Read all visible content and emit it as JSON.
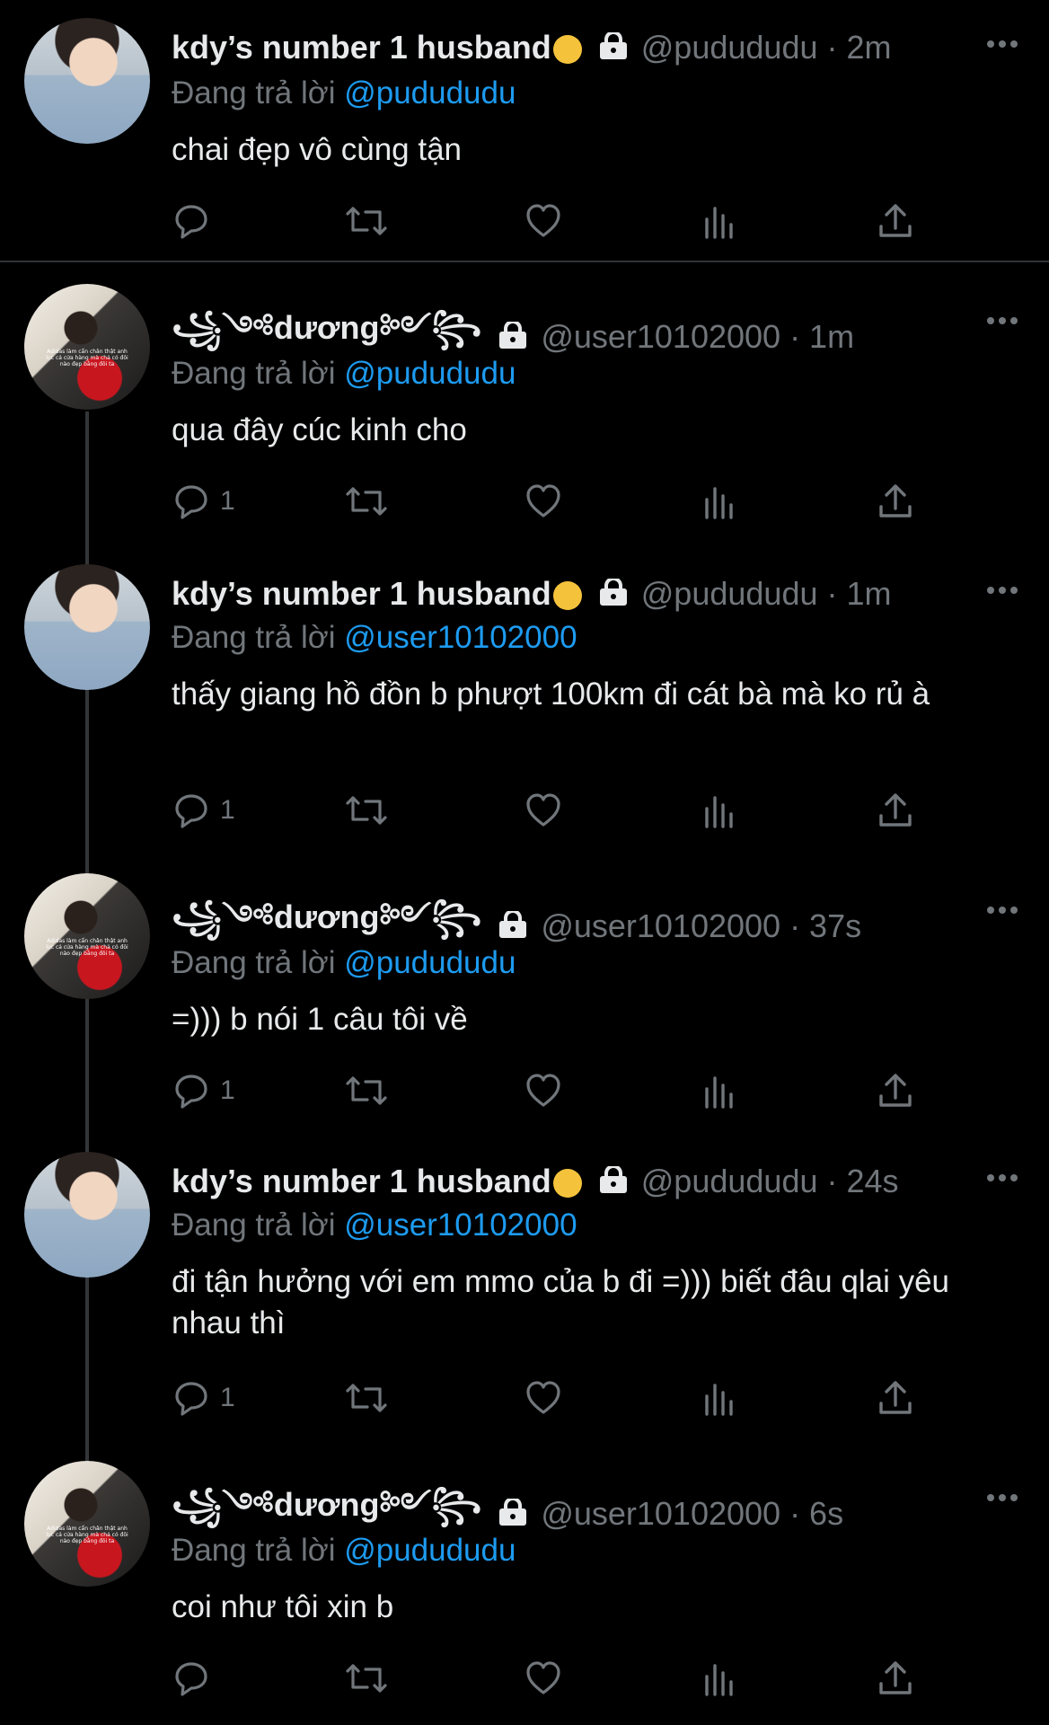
{
  "reply_prefix": "Đang trả lời",
  "tweets": [
    {
      "name": "kdy’s number 1 husband",
      "handle": "@pudududu",
      "time": "· 2m",
      "reply_to": "@pudududu",
      "text": "chai đẹp vô cùng tận",
      "reply_count": ""
    },
    {
      "name": "꧁༺dương༻꧂",
      "handle": "@user10102000",
      "time": "· 1m",
      "reply_to": "@pudududu",
      "text": "qua đây cúc kinh cho",
      "reply_count": "1"
    },
    {
      "name": "kdy’s number 1 husband",
      "handle": "@pudududu",
      "time": "· 1m",
      "reply_to": "@user10102000",
      "text": "thấy giang hồ đồn b phượt 100km đi cát bà mà ko rủ à",
      "reply_count": "1"
    },
    {
      "name": "꧁༺dương༻꧂",
      "handle": "@user10102000",
      "time": "· 37s",
      "reply_to": "@pudududu",
      "text": "=))) b nói 1 câu tôi về",
      "reply_count": "1"
    },
    {
      "name": "kdy’s number 1 husband",
      "handle": "@pudududu",
      "time": "· 24s",
      "reply_to": "@user10102000",
      "text": "đi tận hưởng với em mmo của b đi =))) biết đâu qlai yêu nhau thì",
      "reply_count": "1"
    },
    {
      "name": "꧁༺dương༻꧂",
      "handle": "@user10102000",
      "time": "· 6s",
      "reply_to": "@pudududu",
      "text": "coi như tôi xin b",
      "reply_count": ""
    }
  ],
  "avatar_caption": "Adidas làm cẩn chân thật anh lục cả cửa hàng mà chả có đôi nào đẹp bằng đôi ta",
  "icons": {
    "reply": "reply-icon",
    "retweet": "retweet-icon",
    "like": "heart-icon",
    "views": "views-icon",
    "share": "share-icon",
    "more": "more-icon",
    "lock": "lock-icon",
    "emoji": "tired-face-emoji"
  },
  "colors": {
    "background": "#000000",
    "text": "#e7e9ea",
    "muted": "#71767b",
    "mention": "#1d9bf0",
    "divider": "#2f3336"
  }
}
